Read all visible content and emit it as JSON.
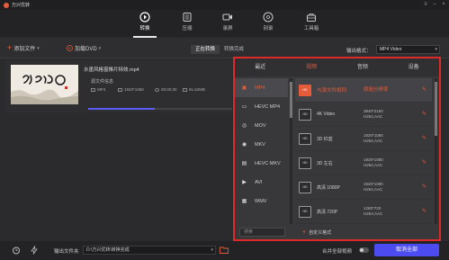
{
  "app": {
    "title": "万兴优转"
  },
  "nav": [
    {
      "label": "转换",
      "icon": "convert-icon"
    },
    {
      "label": "压缩",
      "icon": "compress-icon"
    },
    {
      "label": "录屏",
      "icon": "record-icon"
    },
    {
      "label": "刻录",
      "icon": "burn-icon"
    },
    {
      "label": "工具箱",
      "icon": "toolbox-icon"
    }
  ],
  "toolbar": {
    "add_file": "添加文件",
    "load_dvd": "加载DVD",
    "tab_converting": "正在转换",
    "tab_done": "转换完成",
    "output_format_label": "输出格式：",
    "output_format_value": "MP4 Video"
  },
  "file": {
    "name": "水墨风格窗推片特效.mp4",
    "source_label": "源文件信息",
    "format": "MP4",
    "resolution": "1920*1080",
    "duration": "00:00:30",
    "size": "91.62MB",
    "progress": 0.46
  },
  "panel": {
    "tabs": [
      "最近",
      "视频",
      "音频",
      "设备"
    ],
    "active_tab": 1,
    "formats": [
      "MP4",
      "HEVC MP4",
      "MOV",
      "MKV",
      "HEVC MKV",
      "AVI",
      "WMV"
    ],
    "active_format": 0,
    "resolutions": [
      {
        "name": "与源文件相同",
        "spec": "原始分辨率",
        "spec2": ""
      },
      {
        "name": "4K Video",
        "spec": "3840*2160",
        "spec2": "H264,AAC"
      },
      {
        "name": "3D 红蓝",
        "spec": "1920*1080",
        "spec2": "H264,AAC"
      },
      {
        "name": "3D 左右",
        "spec": "1920*1080",
        "spec2": "H264,AAC"
      },
      {
        "name": "高清 1080P",
        "spec": "1920*1080",
        "spec2": "H264,AAC"
      },
      {
        "name": "高清 720P",
        "spec": "1280*720",
        "spec2": "H264,AAC"
      }
    ],
    "active_resolution": 0,
    "search_placeholder": "搜索",
    "custom_label": "自定义格式"
  },
  "bottom": {
    "output_folder_label": "输出文件夹",
    "output_path": "D:\\万兴优转\\转换完成",
    "merge_label": "合并全部视频",
    "cancel_all": "取消全部"
  },
  "colors": {
    "accent": "#e45c3a",
    "highlight_border": "#e02a2a",
    "button_blue": "#4b4bf0"
  }
}
